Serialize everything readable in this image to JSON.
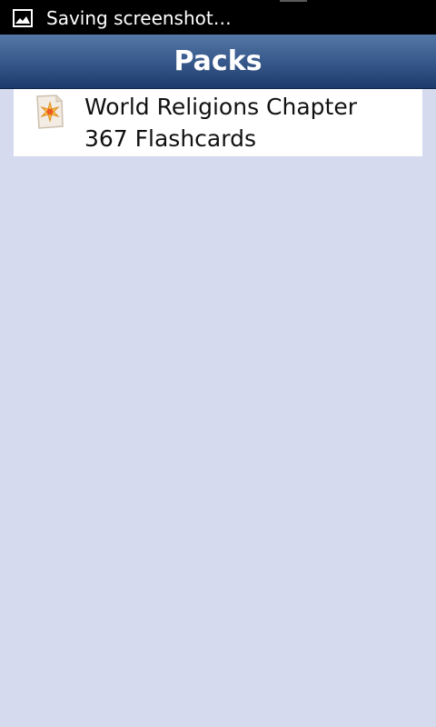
{
  "status_bar": {
    "icon": "image-icon",
    "text": "Saving screenshot…"
  },
  "header": {
    "title": "Packs"
  },
  "packs": [
    {
      "title": "World Religions Chapter",
      "count": "367 Flashcards",
      "icon": "pack-icon"
    }
  ],
  "colors": {
    "status_bar_bg": "#000000",
    "title_bar_top": "#5478a6",
    "title_bar_bottom": "#1d3b6c",
    "content_bg": "#d5daee",
    "list_item_bg": "#ffffff"
  }
}
